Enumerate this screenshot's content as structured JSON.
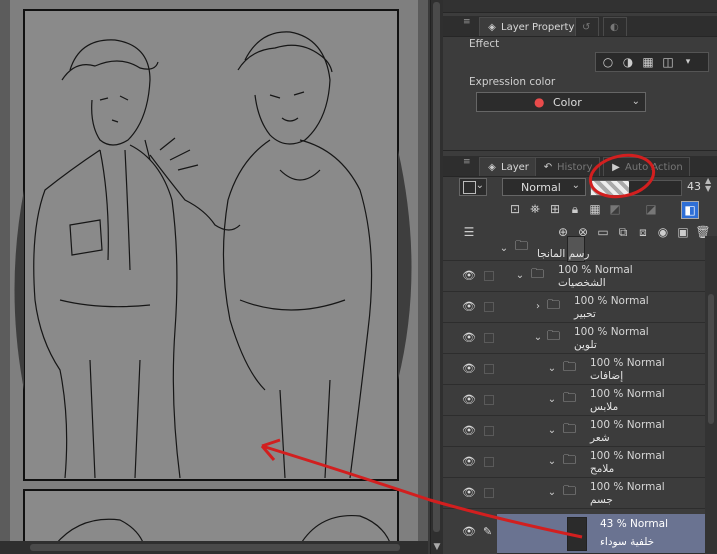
{
  "colors": {
    "canvas_bg": "#5c5c5c",
    "paper": "#808080",
    "panel_bg": "#3c3c3c",
    "selected_row": "#6a7391",
    "annotation_red": "#d21f1f"
  },
  "layer_property": {
    "tab_label": "Layer Property",
    "tab_icon": "layer-property-icon",
    "effect_label": "Effect",
    "expression_color_label": "Expression color",
    "color_dropdown_value": "Color"
  },
  "layer_panel": {
    "tabs": [
      {
        "label": "Layer",
        "icon": "layers-icon"
      },
      {
        "label": "History",
        "icon": "history-icon"
      },
      {
        "label": "Auto Action",
        "icon": "auto-action-icon"
      }
    ],
    "blend_mode": "Normal",
    "opacity_value": "43"
  },
  "layers": [
    {
      "mode": "",
      "name": "رسم المانجا"
    },
    {
      "mode": "100 % Normal",
      "name": "الشخصيات"
    },
    {
      "mode": "100 % Normal",
      "name": "تحبير"
    },
    {
      "mode": "100 % Normal",
      "name": "تلوين"
    },
    {
      "mode": "100 % Normal",
      "name": "إضافات"
    },
    {
      "mode": "100 % Normal",
      "name": "ملابس"
    },
    {
      "mode": "100 % Normal",
      "name": "شعر"
    },
    {
      "mode": "100 % Normal",
      "name": "ملامح"
    },
    {
      "mode": "100 % Normal",
      "name": "جسم"
    },
    {
      "mode": "43 % Normal",
      "name": "خلفية سوداء"
    }
  ]
}
